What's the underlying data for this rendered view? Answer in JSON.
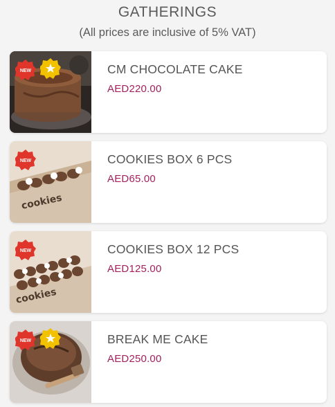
{
  "header": {
    "title": "GATHERINGS",
    "subtitle": "(All prices are inclusive of 5% VAT)"
  },
  "badges": {
    "new_label": "NEW"
  },
  "products": [
    {
      "name": "CM CHOCOLATE CAKE",
      "price": "AED220.00",
      "badges": [
        "new-icon",
        "star-icon"
      ]
    },
    {
      "name": "COOKIES BOX 6 PCS",
      "price": "AED65.00",
      "badges": [
        "new-icon"
      ]
    },
    {
      "name": "COOKIES BOX 12 PCS",
      "price": "AED125.00",
      "badges": [
        "new-icon"
      ]
    },
    {
      "name": "BREAK ME CAKE",
      "price": "AED250.00",
      "badges": [
        "new-icon",
        "star-icon"
      ]
    }
  ],
  "colors": {
    "price": "#a3205e",
    "new_badge": "#e0352b",
    "star_badge": "#f2c200",
    "card_bg": "#ffffff",
    "page_bg": "#f4f4f4"
  }
}
